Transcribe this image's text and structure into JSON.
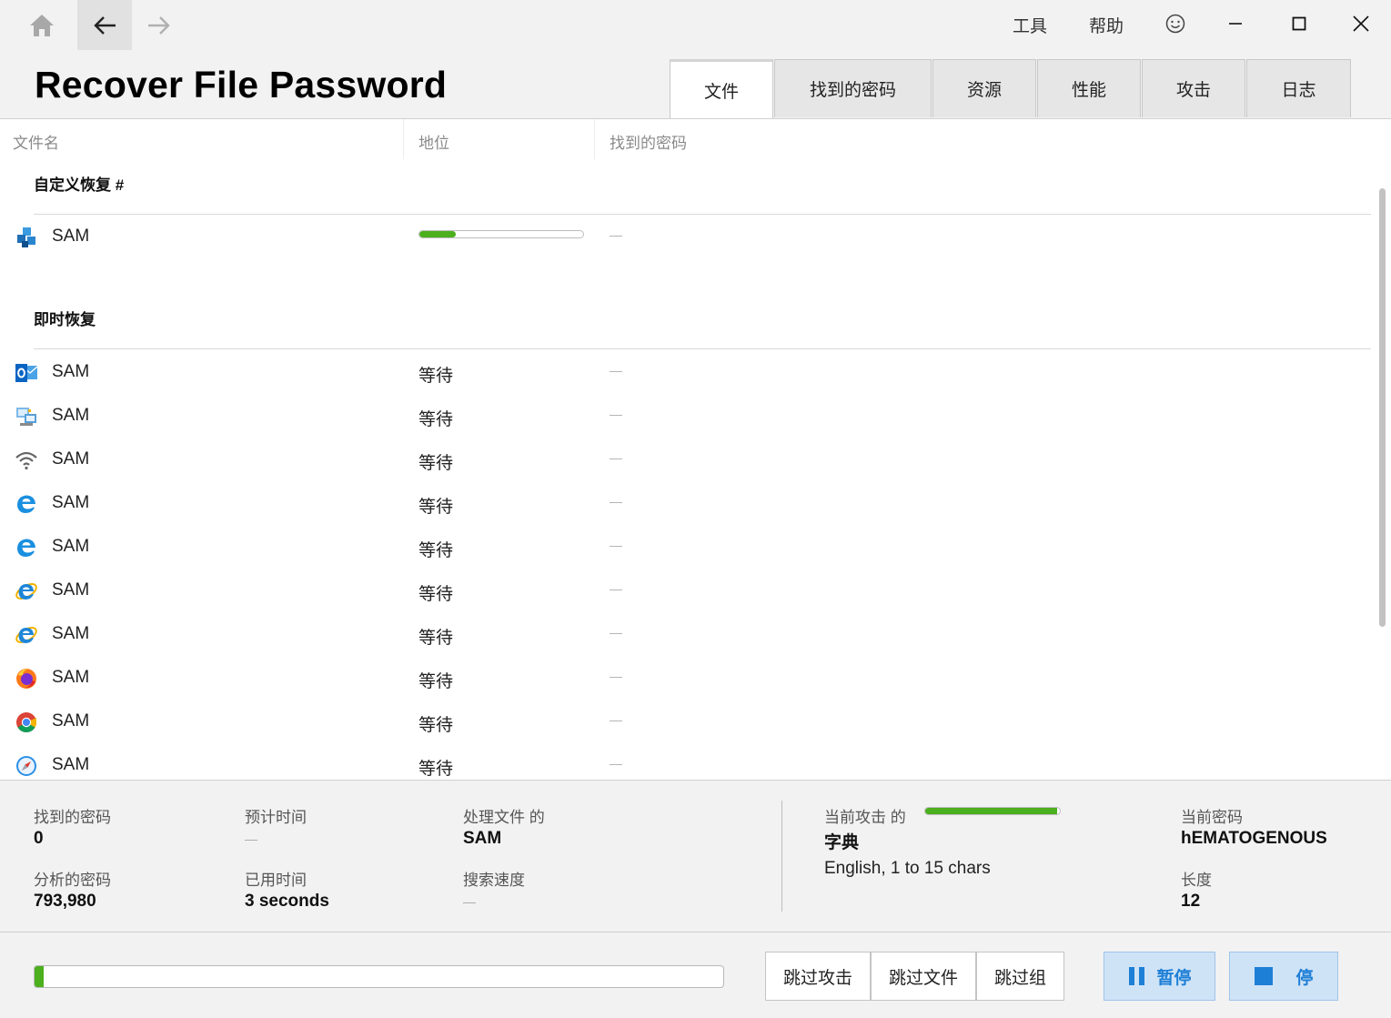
{
  "app": {
    "title": "Recover File Password"
  },
  "menu": {
    "tools": "工具",
    "help": "帮助"
  },
  "tabs": [
    {
      "label": "文件",
      "active": true
    },
    {
      "label": "找到的密码",
      "active": false
    },
    {
      "label": "资源",
      "active": false
    },
    {
      "label": "性能",
      "active": false
    },
    {
      "label": "攻击",
      "active": false
    },
    {
      "label": "日志",
      "active": false
    }
  ],
  "columns": {
    "filename": "文件名",
    "status": "地位",
    "found_password": "找到的密码"
  },
  "groups": {
    "custom": {
      "title": "自定义恢复 #",
      "rows": [
        {
          "icon": "registry-cubes-icon",
          "name": "SAM",
          "progress": 0.22,
          "password": "—"
        }
      ]
    },
    "instant": {
      "title": "即时恢复",
      "rows": [
        {
          "icon": "outlook-icon",
          "name": "SAM",
          "status": "等待",
          "password": "—"
        },
        {
          "icon": "network-computer-icon",
          "name": "SAM",
          "status": "等待",
          "password": "—"
        },
        {
          "icon": "wifi-icon",
          "name": "SAM",
          "status": "等待",
          "password": "—"
        },
        {
          "icon": "edge-icon",
          "name": "SAM",
          "status": "等待",
          "password": "—"
        },
        {
          "icon": "edge-icon",
          "name": "SAM",
          "status": "等待",
          "password": "—"
        },
        {
          "icon": "internet-explorer-icon",
          "name": "SAM",
          "status": "等待",
          "password": "—"
        },
        {
          "icon": "internet-explorer-icon",
          "name": "SAM",
          "status": "等待",
          "password": "—"
        },
        {
          "icon": "firefox-icon",
          "name": "SAM",
          "status": "等待",
          "password": "—"
        },
        {
          "icon": "chrome-icon",
          "name": "SAM",
          "status": "等待",
          "password": "—"
        },
        {
          "icon": "safari-icon",
          "name": "SAM",
          "status": "等待",
          "password": "—"
        }
      ]
    }
  },
  "stats": {
    "found_passwords_label": "找到的密码",
    "found_passwords": "0",
    "analyzed_label": "分析的密码",
    "analyzed": "793,980",
    "eta_label": "预计时间",
    "eta": "—",
    "elapsed_label": "已用时间",
    "elapsed": "3 seconds",
    "processing_label": "处理文件 的",
    "processing": "SAM",
    "speed_label": "搜索速度",
    "speed": "—",
    "current_attack_label": "当前攻击 的",
    "current_attack_progress": 0.98,
    "attack_name": "字典",
    "attack_desc": "English, 1 to 15 chars",
    "current_password_label": "当前密码",
    "current_password": "hEMATOGENOUS",
    "length_label": "长度",
    "length": "12"
  },
  "bottom": {
    "overall_progress": 0.013,
    "skip_attack": "跳过攻击",
    "skip_file": "跳过文件",
    "skip_group": "跳过组",
    "pause": "暂停",
    "stop": "停"
  },
  "colors": {
    "accent_green": "#4caf1e",
    "button_blue": "#1e7fd6"
  }
}
